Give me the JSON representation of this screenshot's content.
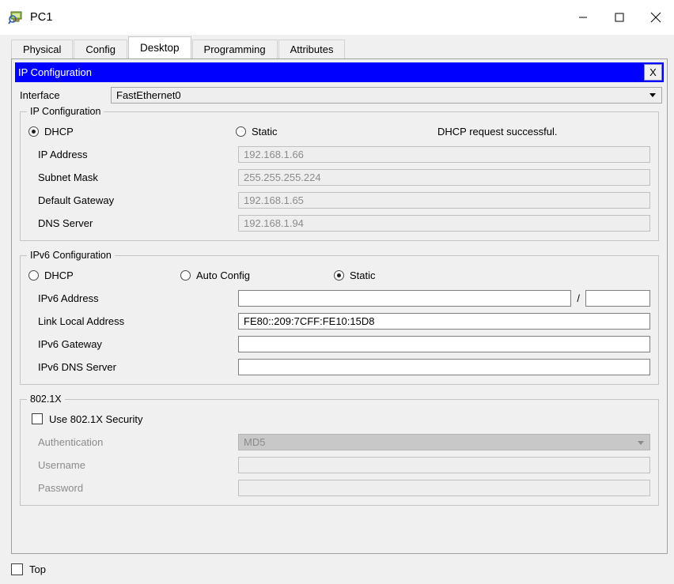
{
  "window": {
    "title": "PC1",
    "icon": "pc-device-icon",
    "controls": {
      "minimize": "minimize-icon",
      "maximize": "maximize-icon",
      "close": "close-icon"
    }
  },
  "tabs": [
    {
      "label": "Physical",
      "active": false
    },
    {
      "label": "Config",
      "active": false
    },
    {
      "label": "Desktop",
      "active": true
    },
    {
      "label": "Programming",
      "active": false
    },
    {
      "label": "Attributes",
      "active": false
    }
  ],
  "dialog": {
    "title": "IP Configuration",
    "close_label": "X",
    "accent_color": "#0000ff"
  },
  "interface": {
    "label": "Interface",
    "value": "FastEthernet0",
    "options": [
      "FastEthernet0"
    ]
  },
  "ipv4": {
    "group_title": "IP Configuration",
    "mode": "DHCP",
    "options": [
      {
        "label": "DHCP",
        "selected": true
      },
      {
        "label": "Static",
        "selected": false
      }
    ],
    "status": "DHCP request successful.",
    "fields": [
      {
        "label": "IP Address",
        "value": "192.168.1.66",
        "enabled": false
      },
      {
        "label": "Subnet Mask",
        "value": "255.255.255.224",
        "enabled": false
      },
      {
        "label": "Default Gateway",
        "value": "192.168.1.65",
        "enabled": false
      },
      {
        "label": "DNS Server",
        "value": "192.168.1.94",
        "enabled": false
      }
    ]
  },
  "ipv6": {
    "group_title": "IPv6 Configuration",
    "mode": "Static",
    "options": [
      {
        "label": "DHCP",
        "selected": false
      },
      {
        "label": "Auto Config",
        "selected": false
      },
      {
        "label": "Static",
        "selected": true
      }
    ],
    "address": {
      "label": "IPv6 Address",
      "value": "",
      "prefix": "",
      "separator": "/"
    },
    "fields": [
      {
        "label": "Link Local Address",
        "value": "FE80::209:7CFF:FE10:15D8",
        "enabled": true
      },
      {
        "label": "IPv6 Gateway",
        "value": "",
        "enabled": true
      },
      {
        "label": "IPv6 DNS Server",
        "value": "",
        "enabled": true
      }
    ]
  },
  "dot1x": {
    "group_title": "802.1X",
    "use_security": {
      "label": "Use 802.1X Security",
      "checked": false
    },
    "authentication": {
      "label": "Authentication",
      "value": "MD5",
      "enabled": false
    },
    "username": {
      "label": "Username",
      "value": "",
      "enabled": false
    },
    "password": {
      "label": "Password",
      "value": "",
      "enabled": false
    }
  },
  "footer": {
    "top_checkbox": {
      "label": "Top",
      "checked": false
    }
  }
}
